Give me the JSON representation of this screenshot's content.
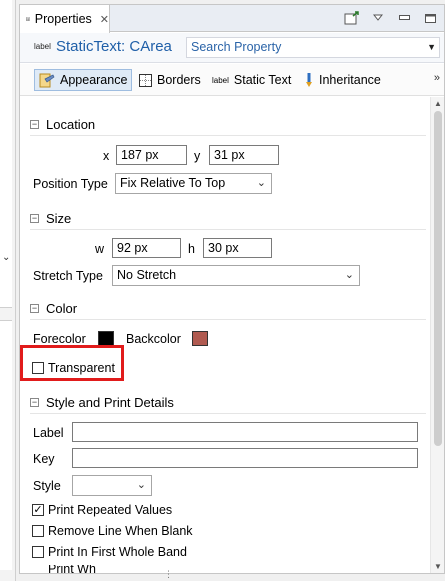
{
  "view": {
    "tab_label": "Properties",
    "tools": [
      "pin-icon",
      "view-menu-icon",
      "minimize-icon",
      "maximize-icon"
    ]
  },
  "element": {
    "type_badge": "label",
    "title": "StaticText: CArea",
    "search_placeholder": "Search Property"
  },
  "subtabs": [
    {
      "label": "Appearance",
      "icon": "appearance-icon",
      "active": true
    },
    {
      "label": "Borders",
      "icon": "borders-icon",
      "active": false
    },
    {
      "label": "Static Text",
      "icon": "static-text-icon",
      "badge": "label",
      "active": false
    },
    {
      "label": "Inheritance",
      "icon": "inheritance-icon",
      "active": false
    }
  ],
  "more_glyph": "»",
  "location": {
    "title": "Location",
    "x_label": "x",
    "x_value": "187 px",
    "y_label": "y",
    "y_value": "31 px",
    "position_type_label": "Position Type",
    "position_type_value": "Fix Relative To Top"
  },
  "size": {
    "title": "Size",
    "w_label": "w",
    "w_value": "92 px",
    "h_label": "h",
    "h_value": "30 px",
    "stretch_type_label": "Stretch Type",
    "stretch_type_value": "No Stretch"
  },
  "color": {
    "title": "Color",
    "forecolor_label": "Forecolor",
    "forecolor": "#000000",
    "backcolor_label": "Backcolor",
    "backcolor": "#b05a50",
    "transparent_label": "Transparent",
    "transparent_checked": false
  },
  "style_print": {
    "title": "Style and Print Details",
    "label_label": "Label",
    "label_value": "",
    "key_label": "Key",
    "key_value": "",
    "style_label": "Style",
    "style_value": "",
    "print_repeated_values_label": "Print Repeated Values",
    "print_repeated_values_checked": true,
    "remove_line_when_blank_label": "Remove Line When Blank",
    "remove_line_when_blank_checked": false,
    "print_in_first_whole_band_label": "Print In First Whole Band",
    "print_in_first_whole_band_checked": false,
    "print_when_partial": "Print Wh"
  },
  "colors": {
    "accent": "#1f5fa8",
    "highlight": "#e11b1b"
  }
}
